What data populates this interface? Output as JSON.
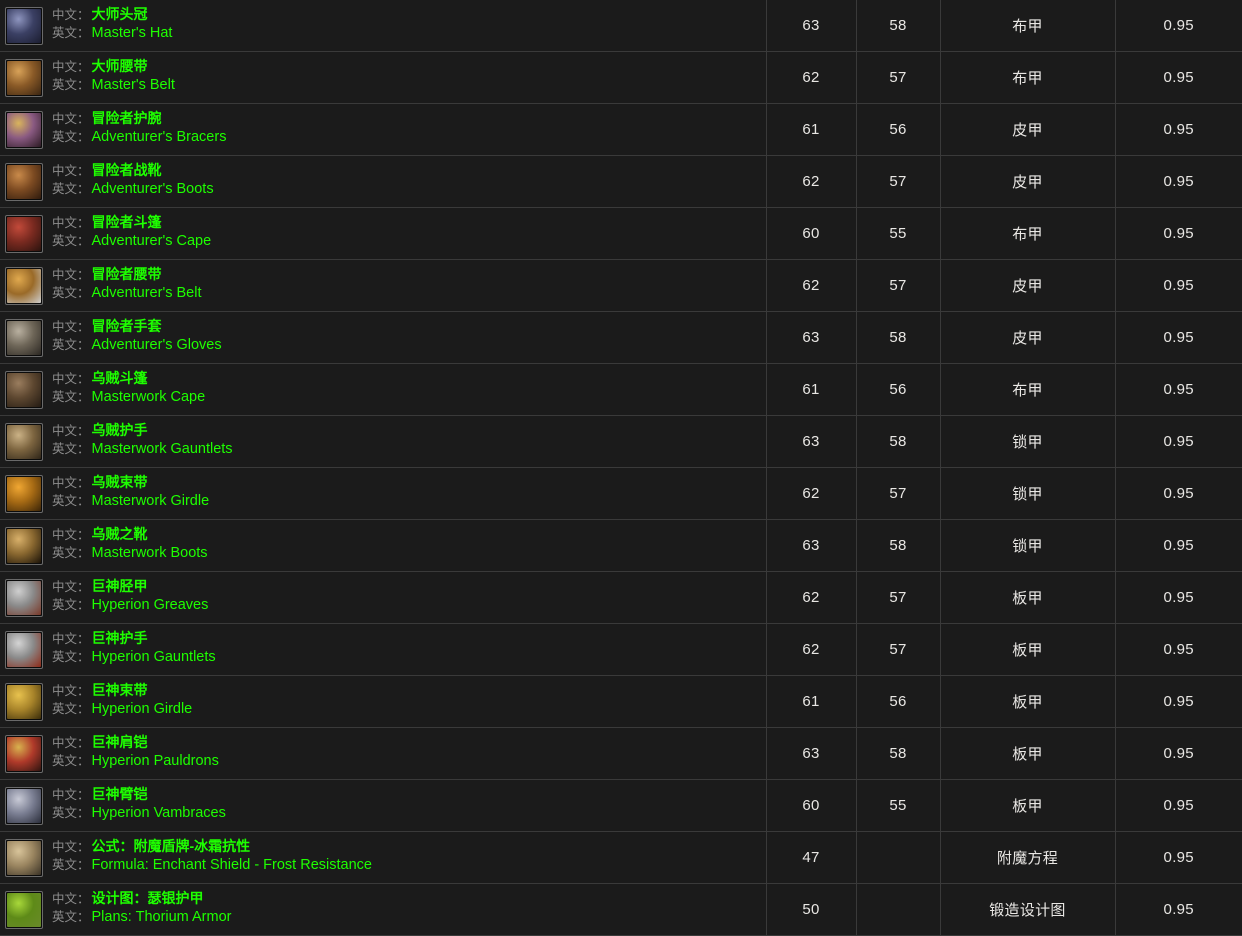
{
  "labels": {
    "zh_key": "中文：",
    "en_key": "英文："
  },
  "table": {
    "rows": [
      {
        "icon": "hat-icon",
        "icon_colors": [
          "#8e95bf",
          "#3b4064",
          "#1b1d30"
        ],
        "zh": "大师头冠",
        "en": "Master's Hat",
        "level": "63",
        "req": "58",
        "type": "布甲",
        "rate": "0.95"
      },
      {
        "icon": "belt-icon",
        "icon_colors": [
          "#d8a258",
          "#8a5a27",
          "#3a2512"
        ],
        "zh": "大师腰带",
        "en": "Master's Belt",
        "level": "62",
        "req": "57",
        "type": "布甲",
        "rate": "0.95"
      },
      {
        "icon": "bracers-icon",
        "icon_colors": [
          "#d9b45c",
          "#8a5a82",
          "#2b1a22"
        ],
        "zh": "冒险者护腕",
        "en": "Adventurer's Bracers",
        "level": "61",
        "req": "56",
        "type": "皮甲",
        "rate": "0.95"
      },
      {
        "icon": "boots-icon",
        "icon_colors": [
          "#c98a4a",
          "#7d4b22",
          "#2e1a0d"
        ],
        "zh": "冒险者战靴",
        "en": "Adventurer's Boots",
        "level": "62",
        "req": "57",
        "type": "皮甲",
        "rate": "0.95"
      },
      {
        "icon": "cape-icon",
        "icon_colors": [
          "#c24a3a",
          "#7a2a20",
          "#2a130e"
        ],
        "zh": "冒险者斗篷",
        "en": "Adventurer's Cape",
        "level": "60",
        "req": "55",
        "type": "布甲",
        "rate": "0.95"
      },
      {
        "icon": "belt-buckle-icon",
        "icon_colors": [
          "#e0a94e",
          "#9a6a28",
          "#cfcfcf"
        ],
        "zh": "冒险者腰带",
        "en": "Adventurer's Belt",
        "level": "62",
        "req": "57",
        "type": "皮甲",
        "rate": "0.95"
      },
      {
        "icon": "gloves-icon",
        "icon_colors": [
          "#b9b0a0",
          "#6e6658",
          "#2b2722"
        ],
        "zh": "冒险者手套",
        "en": "Adventurer's Gloves",
        "level": "63",
        "req": "58",
        "type": "皮甲",
        "rate": "0.95"
      },
      {
        "icon": "cloth-cape-icon",
        "icon_colors": [
          "#9a7d5e",
          "#5d4730",
          "#231a12"
        ],
        "zh": "乌贼斗篷",
        "en": "Masterwork Cape",
        "level": "61",
        "req": "56",
        "type": "布甲",
        "rate": "0.95"
      },
      {
        "icon": "gauntlets-icon",
        "icon_colors": [
          "#cbb286",
          "#7d6540",
          "#2d2418"
        ],
        "zh": "乌贼护手",
        "en": "Masterwork Gauntlets",
        "level": "63",
        "req": "58",
        "type": "锁甲",
        "rate": "0.95"
      },
      {
        "icon": "girdle-icon",
        "icon_colors": [
          "#f0a733",
          "#a66a14",
          "#3a2408"
        ],
        "zh": "乌贼束带",
        "en": "Masterwork Girdle",
        "level": "62",
        "req": "57",
        "type": "锁甲",
        "rate": "0.95"
      },
      {
        "icon": "mail-boots-icon",
        "icon_colors": [
          "#d8b06a",
          "#8a6830",
          "#1a1208"
        ],
        "zh": "乌贼之靴",
        "en": "Masterwork Boots",
        "level": "63",
        "req": "58",
        "type": "锁甲",
        "rate": "0.95"
      },
      {
        "icon": "greaves-icon",
        "icon_colors": [
          "#cfcfcf",
          "#8a8a8a",
          "#7a3828"
        ],
        "zh": "巨神胫甲",
        "en": "Hyperion Greaves",
        "level": "62",
        "req": "57",
        "type": "板甲",
        "rate": "0.95"
      },
      {
        "icon": "plate-gauntlets-icon",
        "icon_colors": [
          "#d4d4d4",
          "#8a8a8a",
          "#8e2a18"
        ],
        "zh": "巨神护手",
        "en": "Hyperion Gauntlets",
        "level": "62",
        "req": "57",
        "type": "板甲",
        "rate": "0.95"
      },
      {
        "icon": "plate-girdle-icon",
        "icon_colors": [
          "#e8c24e",
          "#a8842a",
          "#3a2c0a"
        ],
        "zh": "巨神束带",
        "en": "Hyperion Girdle",
        "level": "61",
        "req": "56",
        "type": "板甲",
        "rate": "0.95"
      },
      {
        "icon": "pauldrons-icon",
        "icon_colors": [
          "#d8b24e",
          "#b03a2a",
          "#2e1410"
        ],
        "zh": "巨神肩铠",
        "en": "Hyperion Pauldrons",
        "level": "63",
        "req": "58",
        "type": "板甲",
        "rate": "0.95"
      },
      {
        "icon": "vambraces-icon",
        "icon_colors": [
          "#c8cad6",
          "#7a7e92",
          "#2a2d3a"
        ],
        "zh": "巨神臂铠",
        "en": "Hyperion Vambraces",
        "level": "60",
        "req": "55",
        "type": "板甲",
        "rate": "0.95"
      },
      {
        "icon": "formula-scroll-icon",
        "icon_colors": [
          "#d8c49a",
          "#9a8560",
          "#3a3226"
        ],
        "zh": "公式：附魔盾牌-冰霜抗性",
        "en": "Formula: Enchant Shield - Frost Resistance",
        "level": "47",
        "req": "",
        "type": "附魔方程",
        "rate": "0.95"
      },
      {
        "icon": "plans-icon",
        "icon_colors": [
          "#a8d83a",
          "#5e8a18",
          "#6a8a2a"
        ],
        "zh": "设计图：瑟银护甲",
        "en": "Plans: Thorium Armor",
        "level": "50",
        "req": "",
        "type": "锻造设计图",
        "rate": "0.95"
      }
    ]
  }
}
